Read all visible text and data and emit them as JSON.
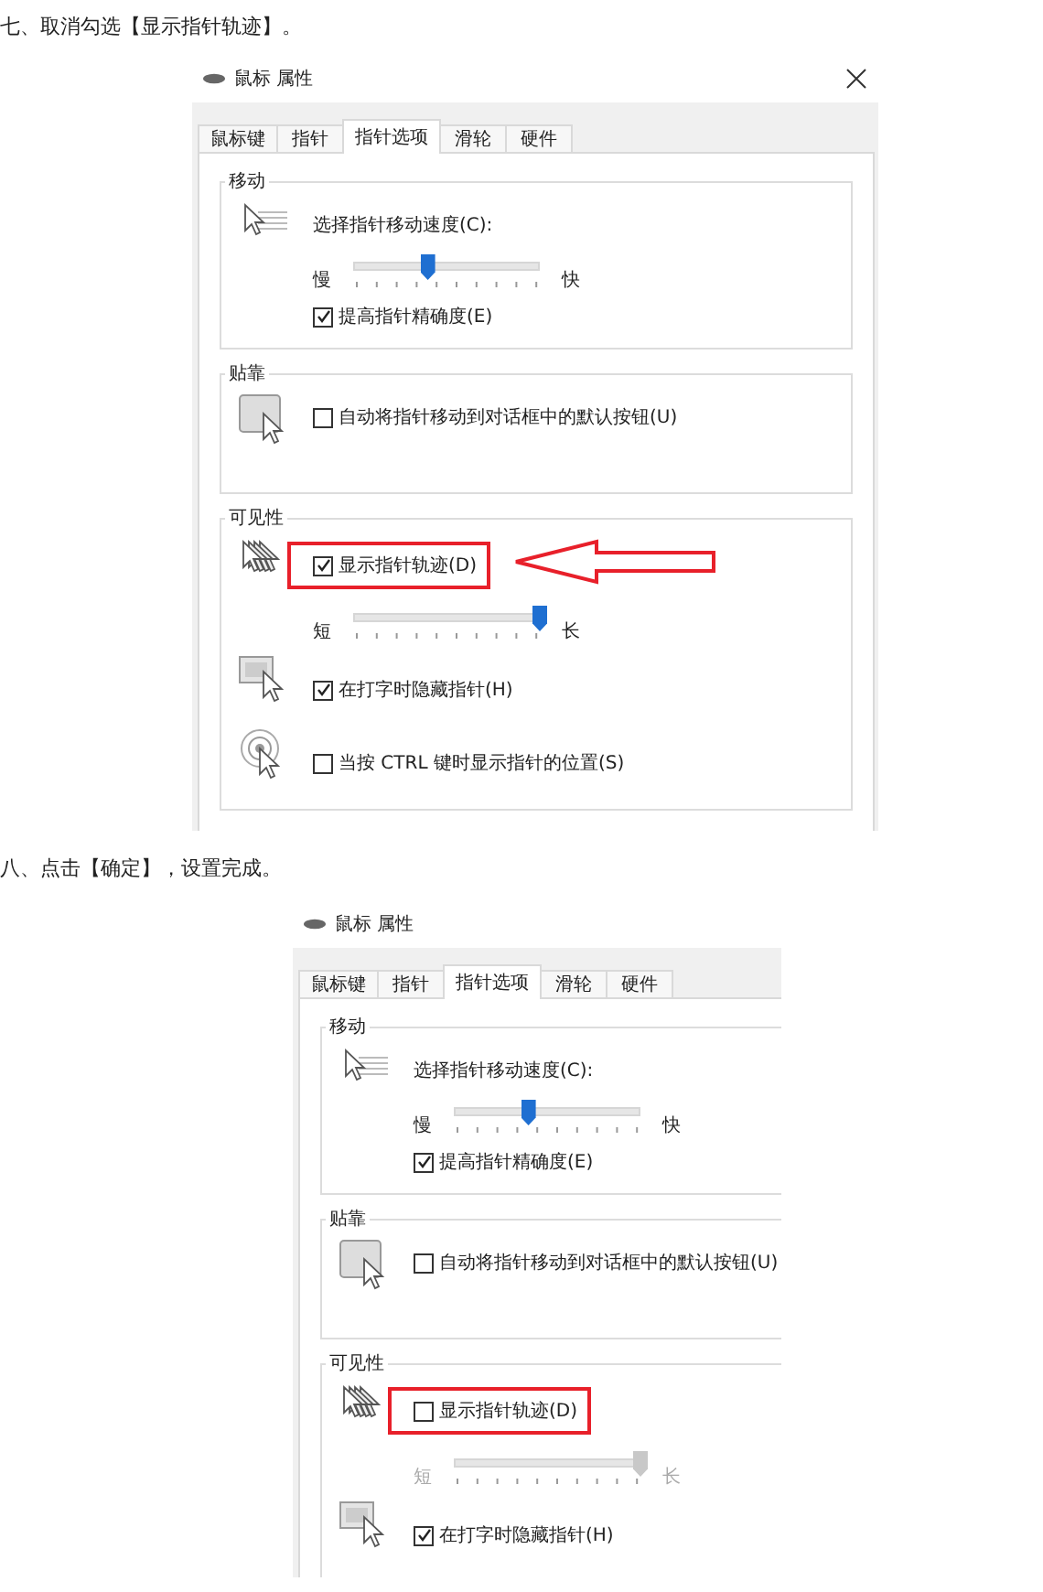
{
  "steps": [
    {
      "text": "七、取消勾选【显示指针轨迹】。",
      "dialog": {
        "title": "鼠标 属性",
        "close_button": true,
        "arrow": true,
        "tabs": [
          {
            "label": "鼠标键",
            "selected": false
          },
          {
            "label": "指针",
            "selected": false
          },
          {
            "label": "指针选项",
            "selected": true
          },
          {
            "label": "滑轮",
            "selected": false
          },
          {
            "label": "硬件",
            "selected": false
          }
        ],
        "groups": [
          {
            "title": "移动",
            "rows": [
              {
                "kind": "speed",
                "label": "选择指针移动速度(C):",
                "min": "慢",
                "max": "快",
                "level": 0.4
              },
              {
                "kind": "checkbox",
                "label": "提高指针精确度(E)",
                "checked": true
              }
            ]
          },
          {
            "title": "贴靠",
            "rows": [
              {
                "kind": "snap",
                "label": "自动将指针移动到对话框中的默认按钮(U)",
                "checked": false
              }
            ]
          },
          {
            "title": "可见性",
            "rows": [
              {
                "kind": "trails",
                "label": "显示指针轨迹(D)",
                "checked": true,
                "highlighted": true,
                "min": "短",
                "max": "长",
                "level": 1
              },
              {
                "kind": "hide",
                "label": "在打字时隐藏指针(H)",
                "checked": true
              },
              {
                "kind": "locate",
                "label": "当按 CTRL 键时显示指针的位置(S)",
                "checked": false
              }
            ]
          }
        ]
      }
    },
    {
      "text": "八、点击【确定】，设置完成。",
      "dialog": {
        "title": "鼠标 属性",
        "close_button": false,
        "arrow": false,
        "tabs": [
          {
            "label": "鼠标键",
            "selected": false
          },
          {
            "label": "指针",
            "selected": false
          },
          {
            "label": "指针选项",
            "selected": true
          },
          {
            "label": "滑轮",
            "selected": false
          },
          {
            "label": "硬件",
            "selected": false
          }
        ],
        "groups": [
          {
            "title": "移动",
            "rows": [
              {
                "kind": "speed",
                "label": "选择指针移动速度(C):",
                "min": "慢",
                "max": "快",
                "level": 0.4
              },
              {
                "kind": "checkbox",
                "label": "提高指针精确度(E)",
                "checked": true
              }
            ]
          },
          {
            "title": "贴靠",
            "rows": [
              {
                "kind": "snap",
                "label": "自动将指针移动到对话框中的默认按钮(U)",
                "checked": false
              }
            ]
          },
          {
            "title": "可见性",
            "rows": [
              {
                "kind": "trails",
                "label": "显示指针轨迹(D)",
                "checked": false,
                "highlighted": true,
                "min": "短",
                "max": "长",
                "level": 1
              },
              {
                "kind": "hide",
                "label": "在打字时隐藏指针(H)",
                "checked": true
              }
            ]
          }
        ]
      }
    }
  ]
}
